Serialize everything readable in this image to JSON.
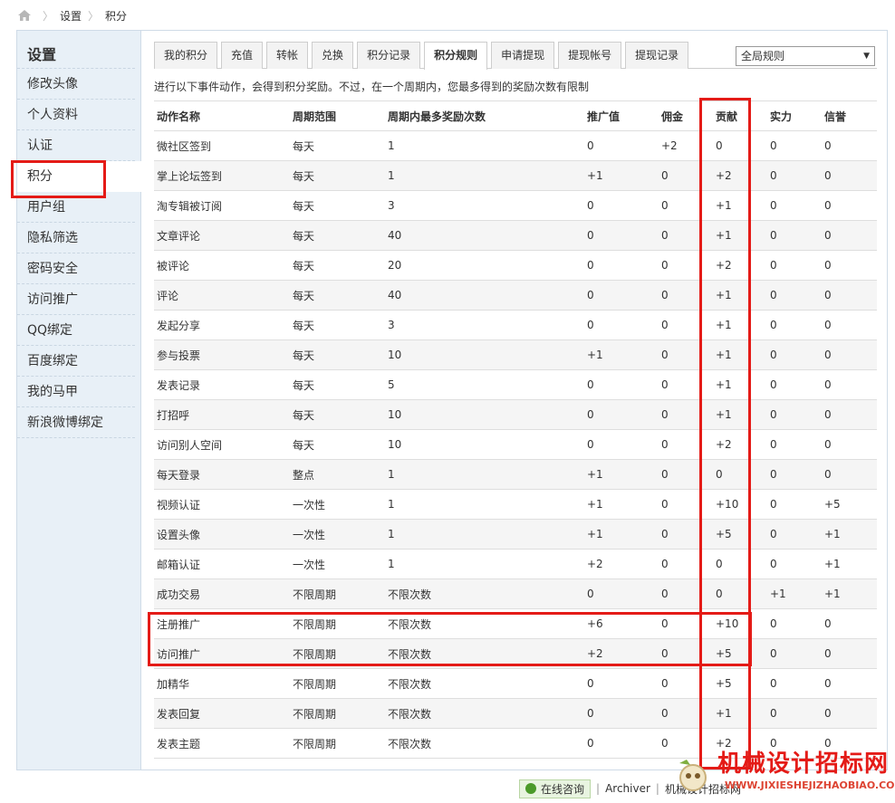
{
  "breadcrumb": {
    "items": [
      "设置",
      "积分"
    ]
  },
  "sidebar": {
    "title": "设置",
    "items": [
      "修改头像",
      "个人资料",
      "认证",
      "积分",
      "用户组",
      "隐私筛选",
      "密码安全",
      "访问推广",
      "QQ绑定",
      "百度绑定",
      "我的马甲",
      "新浪微博绑定"
    ],
    "active": "积分"
  },
  "tabs": {
    "items": [
      "我的积分",
      "充值",
      "转帐",
      "兑换",
      "积分记录",
      "积分规则",
      "申请提现",
      "提现帐号",
      "提现记录"
    ],
    "active": "积分规则"
  },
  "rule_select": {
    "value": "全局规则"
  },
  "intro": "进行以下事件动作，会得到积分奖励。不过，在一个周期内，您最多得到的奖励次数有限制",
  "table": {
    "headers": [
      "动作名称",
      "周期范围",
      "周期内最多奖励次数",
      "推广值",
      "佣金",
      "贡献",
      "实力",
      "信誉"
    ],
    "rows": [
      [
        "微社区签到",
        "每天",
        "1",
        "0",
        "+2",
        "0",
        "0",
        "0"
      ],
      [
        "掌上论坛签到",
        "每天",
        "1",
        "+1",
        "0",
        "+2",
        "0",
        "0"
      ],
      [
        "淘专辑被订阅",
        "每天",
        "3",
        "0",
        "0",
        "+1",
        "0",
        "0"
      ],
      [
        "文章评论",
        "每天",
        "40",
        "0",
        "0",
        "+1",
        "0",
        "0"
      ],
      [
        "被评论",
        "每天",
        "20",
        "0",
        "0",
        "+2",
        "0",
        "0"
      ],
      [
        "评论",
        "每天",
        "40",
        "0",
        "0",
        "+1",
        "0",
        "0"
      ],
      [
        "发起分享",
        "每天",
        "3",
        "0",
        "0",
        "+1",
        "0",
        "0"
      ],
      [
        "参与投票",
        "每天",
        "10",
        "+1",
        "0",
        "+1",
        "0",
        "0"
      ],
      [
        "发表记录",
        "每天",
        "5",
        "0",
        "0",
        "+1",
        "0",
        "0"
      ],
      [
        "打招呼",
        "每天",
        "10",
        "0",
        "0",
        "+1",
        "0",
        "0"
      ],
      [
        "访问别人空间",
        "每天",
        "10",
        "0",
        "0",
        "+2",
        "0",
        "0"
      ],
      [
        "每天登录",
        "整点",
        "1",
        "+1",
        "0",
        "0",
        "0",
        "0"
      ],
      [
        "视频认证",
        "一次性",
        "1",
        "+1",
        "0",
        "+10",
        "0",
        "+5"
      ],
      [
        "设置头像",
        "一次性",
        "1",
        "+1",
        "0",
        "+5",
        "0",
        "+1"
      ],
      [
        "邮箱认证",
        "一次性",
        "1",
        "+2",
        "0",
        "0",
        "0",
        "+1"
      ],
      [
        "成功交易",
        "不限周期",
        "不限次数",
        "0",
        "0",
        "0",
        "+1",
        "+1"
      ],
      [
        "注册推广",
        "不限周期",
        "不限次数",
        "+6",
        "0",
        "+10",
        "0",
        "0"
      ],
      [
        "访问推广",
        "不限周期",
        "不限次数",
        "+2",
        "0",
        "+5",
        "0",
        "0"
      ],
      [
        "加精华",
        "不限周期",
        "不限次数",
        "0",
        "0",
        "+5",
        "0",
        "0"
      ],
      [
        "发表回复",
        "不限周期",
        "不限次数",
        "0",
        "0",
        "+1",
        "0",
        "0"
      ],
      [
        "发表主题",
        "不限周期",
        "不限次数",
        "0",
        "0",
        "+2",
        "0",
        "0"
      ]
    ]
  },
  "footer": {
    "consult_label": "在线咨询",
    "archiver_label": "Archiver",
    "more_label": "机械设计招标网"
  },
  "watermark": {
    "text": "机械设计招标网",
    "url": "WWW.JIXIESHEJIZHAOBIAO.COM"
  },
  "colors": {
    "annotation": "#e41b17",
    "sidebar_bg": "#e8f0f7",
    "tab_bg": "#f3f3f3"
  }
}
